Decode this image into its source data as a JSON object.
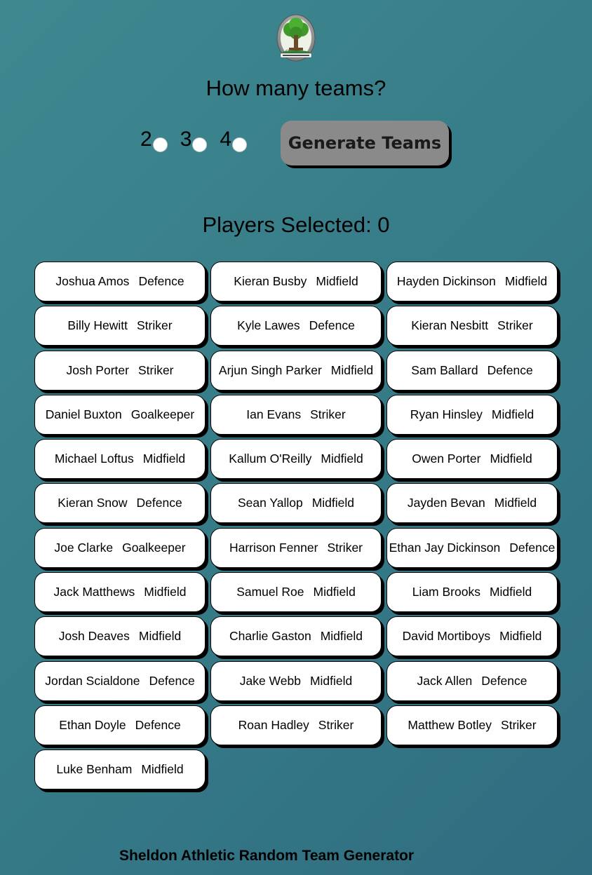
{
  "header": {
    "question": "How many teams?",
    "team_options": [
      "2",
      "3",
      "4"
    ],
    "generate_label": "Generate Teams",
    "players_selected_label": "Players Selected:",
    "players_selected_count": "0",
    "players_selected_text": "Players Selected: 0"
  },
  "players": [
    {
      "name": "Joshua Amos",
      "position": "Defence"
    },
    {
      "name": "Kieran Busby",
      "position": "Midfield"
    },
    {
      "name": "Hayden Dickinson",
      "position": "Midfield"
    },
    {
      "name": "Billy Hewitt",
      "position": "Striker"
    },
    {
      "name": "Kyle Lawes",
      "position": "Defence"
    },
    {
      "name": "Kieran Nesbitt",
      "position": "Striker"
    },
    {
      "name": "Josh Porter",
      "position": "Striker"
    },
    {
      "name": "Arjun Singh Parker",
      "position": "Midfield"
    },
    {
      "name": "Sam Ballard",
      "position": "Defence"
    },
    {
      "name": "Daniel Buxton",
      "position": "Goalkeeper"
    },
    {
      "name": "Ian Evans",
      "position": "Striker"
    },
    {
      "name": "Ryan Hinsley",
      "position": "Midfield"
    },
    {
      "name": "Michael Loftus",
      "position": "Midfield"
    },
    {
      "name": "Kallum O'Reilly",
      "position": "Midfield"
    },
    {
      "name": "Owen Porter",
      "position": "Midfield"
    },
    {
      "name": "Kieran Snow",
      "position": "Defence"
    },
    {
      "name": "Sean Yallop",
      "position": "Midfield"
    },
    {
      "name": "Jayden Bevan",
      "position": "Midfield"
    },
    {
      "name": "Joe Clarke",
      "position": "Goalkeeper"
    },
    {
      "name": "Harrison Fenner",
      "position": "Striker"
    },
    {
      "name": "Ethan Jay Dickinson",
      "position": "Defence"
    },
    {
      "name": "Jack Matthews",
      "position": "Midfield"
    },
    {
      "name": "Samuel Roe",
      "position": "Midfield"
    },
    {
      "name": "Liam Brooks",
      "position": "Midfield"
    },
    {
      "name": "Josh Deaves",
      "position": "Midfield"
    },
    {
      "name": "Charlie Gaston",
      "position": "Midfield"
    },
    {
      "name": "David Mortiboys",
      "position": "Midfield"
    },
    {
      "name": "Jordan Scialdone",
      "position": "Defence"
    },
    {
      "name": "Jake Webb",
      "position": "Midfield"
    },
    {
      "name": "Jack Allen",
      "position": "Defence"
    },
    {
      "name": "Ethan Doyle",
      "position": "Defence"
    },
    {
      "name": "Roan Hadley",
      "position": "Striker"
    },
    {
      "name": "Matthew Botley",
      "position": "Striker"
    },
    {
      "name": "Luke Benham",
      "position": "Midfield"
    }
  ],
  "footer": {
    "text": "Sheldon Athletic Random Team Generator"
  },
  "colors": {
    "background": "#377d89",
    "button_gray": "#8a8a8a",
    "card_bg": "#ffffff"
  },
  "icons": {
    "logo": "club-crest-tree-icon"
  }
}
